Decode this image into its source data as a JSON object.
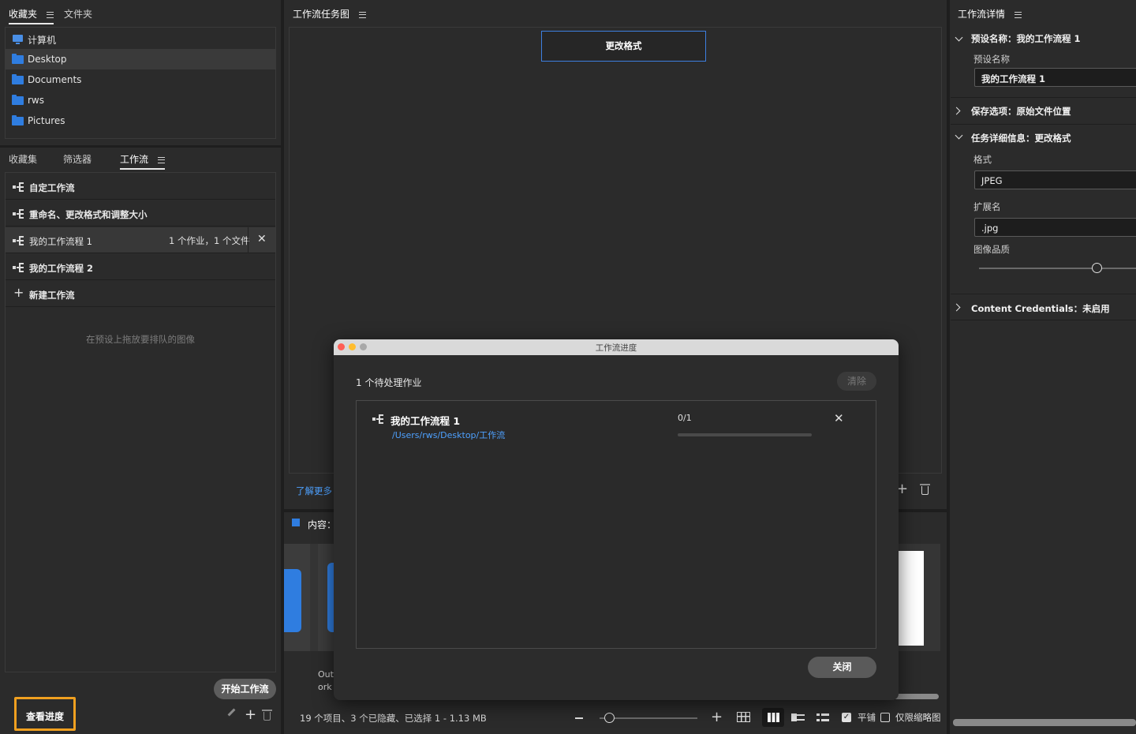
{
  "favorites_panel": {
    "tabs": [
      "收藏夹",
      "文件夹"
    ],
    "items": [
      {
        "label": "计算机",
        "icon": "computer-icon"
      },
      {
        "label": "Desktop",
        "icon": "folder-icon",
        "selected": true
      },
      {
        "label": "Documents",
        "icon": "folder-icon"
      },
      {
        "label": "rws",
        "icon": "folder-icon"
      },
      {
        "label": "Pictures",
        "icon": "folder-icon"
      }
    ]
  },
  "workflow_panel": {
    "tabs": [
      "收藏集",
      "筛选器",
      "工作流"
    ],
    "items": [
      {
        "label": "自定工作流"
      },
      {
        "label": "重命名、更改格式和调整大小"
      },
      {
        "label": "我的工作流程 1",
        "meta": "1 个作业，1 个文件",
        "selected": true
      },
      {
        "label": "我的工作流程 2"
      },
      {
        "label": "新建工作流"
      }
    ],
    "drop_hint": "在预设上拖放要排队的图像",
    "start_button": "开始工作流",
    "progress_button": "查看进度"
  },
  "task_panel": {
    "title": "工作流任务图",
    "task_box": "更改格式",
    "learn_more": "了解更多"
  },
  "content_panel": {
    "title": "内容：",
    "tile_caption_1": "Outp",
    "tile_caption_2": "ork",
    "status": "19 个项目、3 个已隐藏、已选择 1 - 1.13 MB",
    "tile_label": "平铺",
    "thumb_only_label": "仅限缩略图"
  },
  "details_panel": {
    "title": "工作流详情",
    "preset_section": "预设名称：我的工作流程 1",
    "preset_name_label": "预设名称",
    "preset_name_value": "我的工作流程 1",
    "save_section": "保存选项：原始文件位置",
    "task_section": "任务详细信息：更改格式",
    "format_label": "格式",
    "format_value": "JPEG",
    "extension_label": "扩展名",
    "extension_value": ".jpg",
    "quality_label": "图像品质",
    "quality_fraction": 0.75,
    "cc_section": "Content Credentials：未启用"
  },
  "dialog": {
    "title": "工作流进度",
    "pending": "1 个待处理作业",
    "clear_button": "清除",
    "job_name": "我的工作流程 1",
    "job_path": "/Users/rws/Desktop/工作流",
    "job_count": "0/1",
    "job_progress": 0,
    "close_button": "关闭"
  },
  "colors": {
    "accent_blue": "#2f7de0",
    "link_blue": "#4ea1ff",
    "highlight_orange": "#f0a020"
  }
}
